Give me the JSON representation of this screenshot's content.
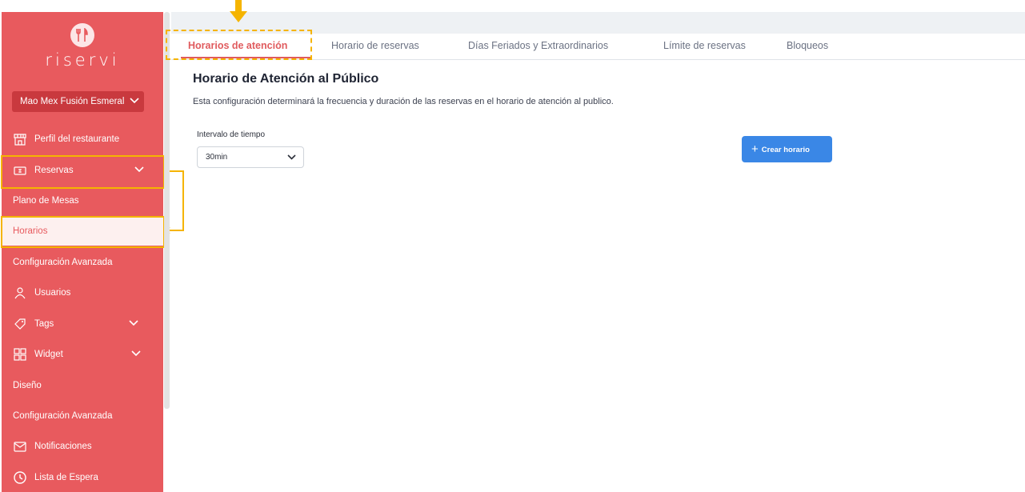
{
  "brand": {
    "name": "riservi",
    "logo_icon": "fork-knife-icon"
  },
  "sidebar": {
    "restaurant": "Mao Mex Fusión Esmeral",
    "items": [
      {
        "label": "Perfil del restaurante",
        "icon": "storefront-icon"
      },
      {
        "label": "Reservas",
        "icon": "ticket-icon"
      },
      {
        "label": "Plano de Mesas"
      },
      {
        "label": "Horarios"
      },
      {
        "label": "Configuración Avanzada"
      },
      {
        "label": "Usuarios",
        "icon": "user-icon"
      },
      {
        "label": "Tags",
        "icon": "tag-icon"
      },
      {
        "label": "Widget",
        "icon": "grid-icon"
      },
      {
        "label": "Diseño"
      },
      {
        "label": "Configuración Avanzada"
      },
      {
        "label": "Notificaciones",
        "icon": "mail-icon"
      },
      {
        "label": "Lista de Espera",
        "icon": "clock-icon"
      }
    ]
  },
  "tabs": [
    {
      "label": "Horarios de atención"
    },
    {
      "label": "Horario de reservas"
    },
    {
      "label": "Días Feriados y Extraordinarios"
    },
    {
      "label": "Límite de reservas"
    },
    {
      "label": "Bloqueos"
    }
  ],
  "main": {
    "title": "Horario de Atención al Público",
    "description": "Esta configuración determinará la frecuencia y duración de las reservas en el horario de atención al publico.",
    "interval_label": "Intervalo de tiempo",
    "interval_value": "30min",
    "create_button": "Crear horario"
  },
  "colors": {
    "sidebar": "#e85a5e",
    "accent": "#e05b5e",
    "button": "#3a87e6",
    "highlight": "#f5b400"
  }
}
